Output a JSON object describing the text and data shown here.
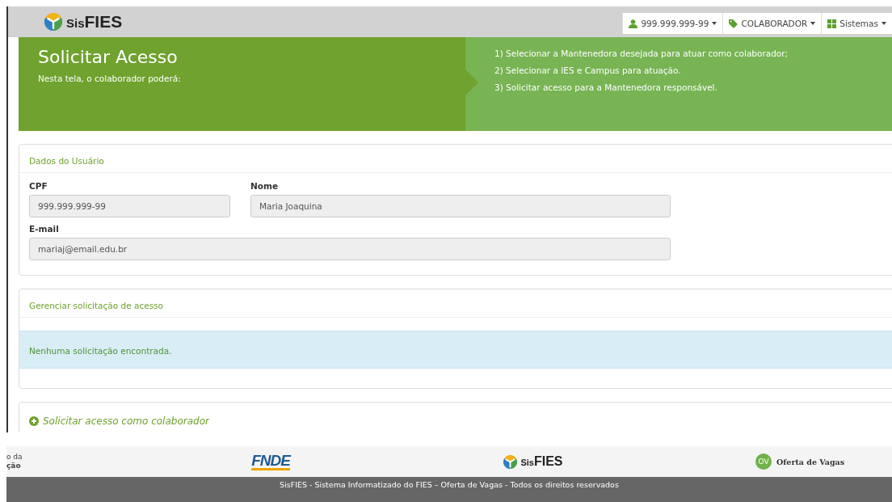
{
  "header": {
    "logo": {
      "prefix": "Sis",
      "name": "FIES"
    },
    "menus": [
      {
        "kind": "user",
        "label": "999.999.999-99"
      },
      {
        "kind": "role",
        "label": "COLABORADOR"
      },
      {
        "kind": "systems",
        "label": "Sistemas"
      }
    ]
  },
  "hero": {
    "title": "Solicitar Acesso",
    "subtitle": "Nesta tela, o colaborador poderá:",
    "steps": [
      "1) Selecionar a Mantenedora desejada para atuar como colaborador;",
      "2) Selecionar a IES e Campus para atuação.",
      "3) Solicitar acesso para a Mantenedora responsável."
    ]
  },
  "user_panel": {
    "title": "Dados do Usuário",
    "fields": [
      {
        "label": "CPF",
        "value": "999.999.999-99"
      },
      {
        "label": "Nome",
        "value": "Maria Joaquina"
      },
      {
        "label": "E-mail",
        "value": "mariaj@email.edu.br"
      }
    ]
  },
  "requests_panel": {
    "title": "Gerenciar solicitação de acesso",
    "message": "Nenhuma solicitação encontrada."
  },
  "request_link": "Solicitar acesso como colaborador",
  "footer": {
    "ministry": [
      "o da",
      "ção"
    ],
    "logos": [
      {
        "kind": "fnde",
        "label": "FNDE"
      },
      {
        "kind": "sisfies",
        "prefix": "Sis",
        "name": "FIES"
      },
      {
        "kind": "ov",
        "badge": "OV",
        "label": "Oferta de Vagas"
      }
    ],
    "copyright": "SisFIES - Sistema Informatizado do FIES – Oferta de Vagas - Todos os direitos reservados"
  }
}
